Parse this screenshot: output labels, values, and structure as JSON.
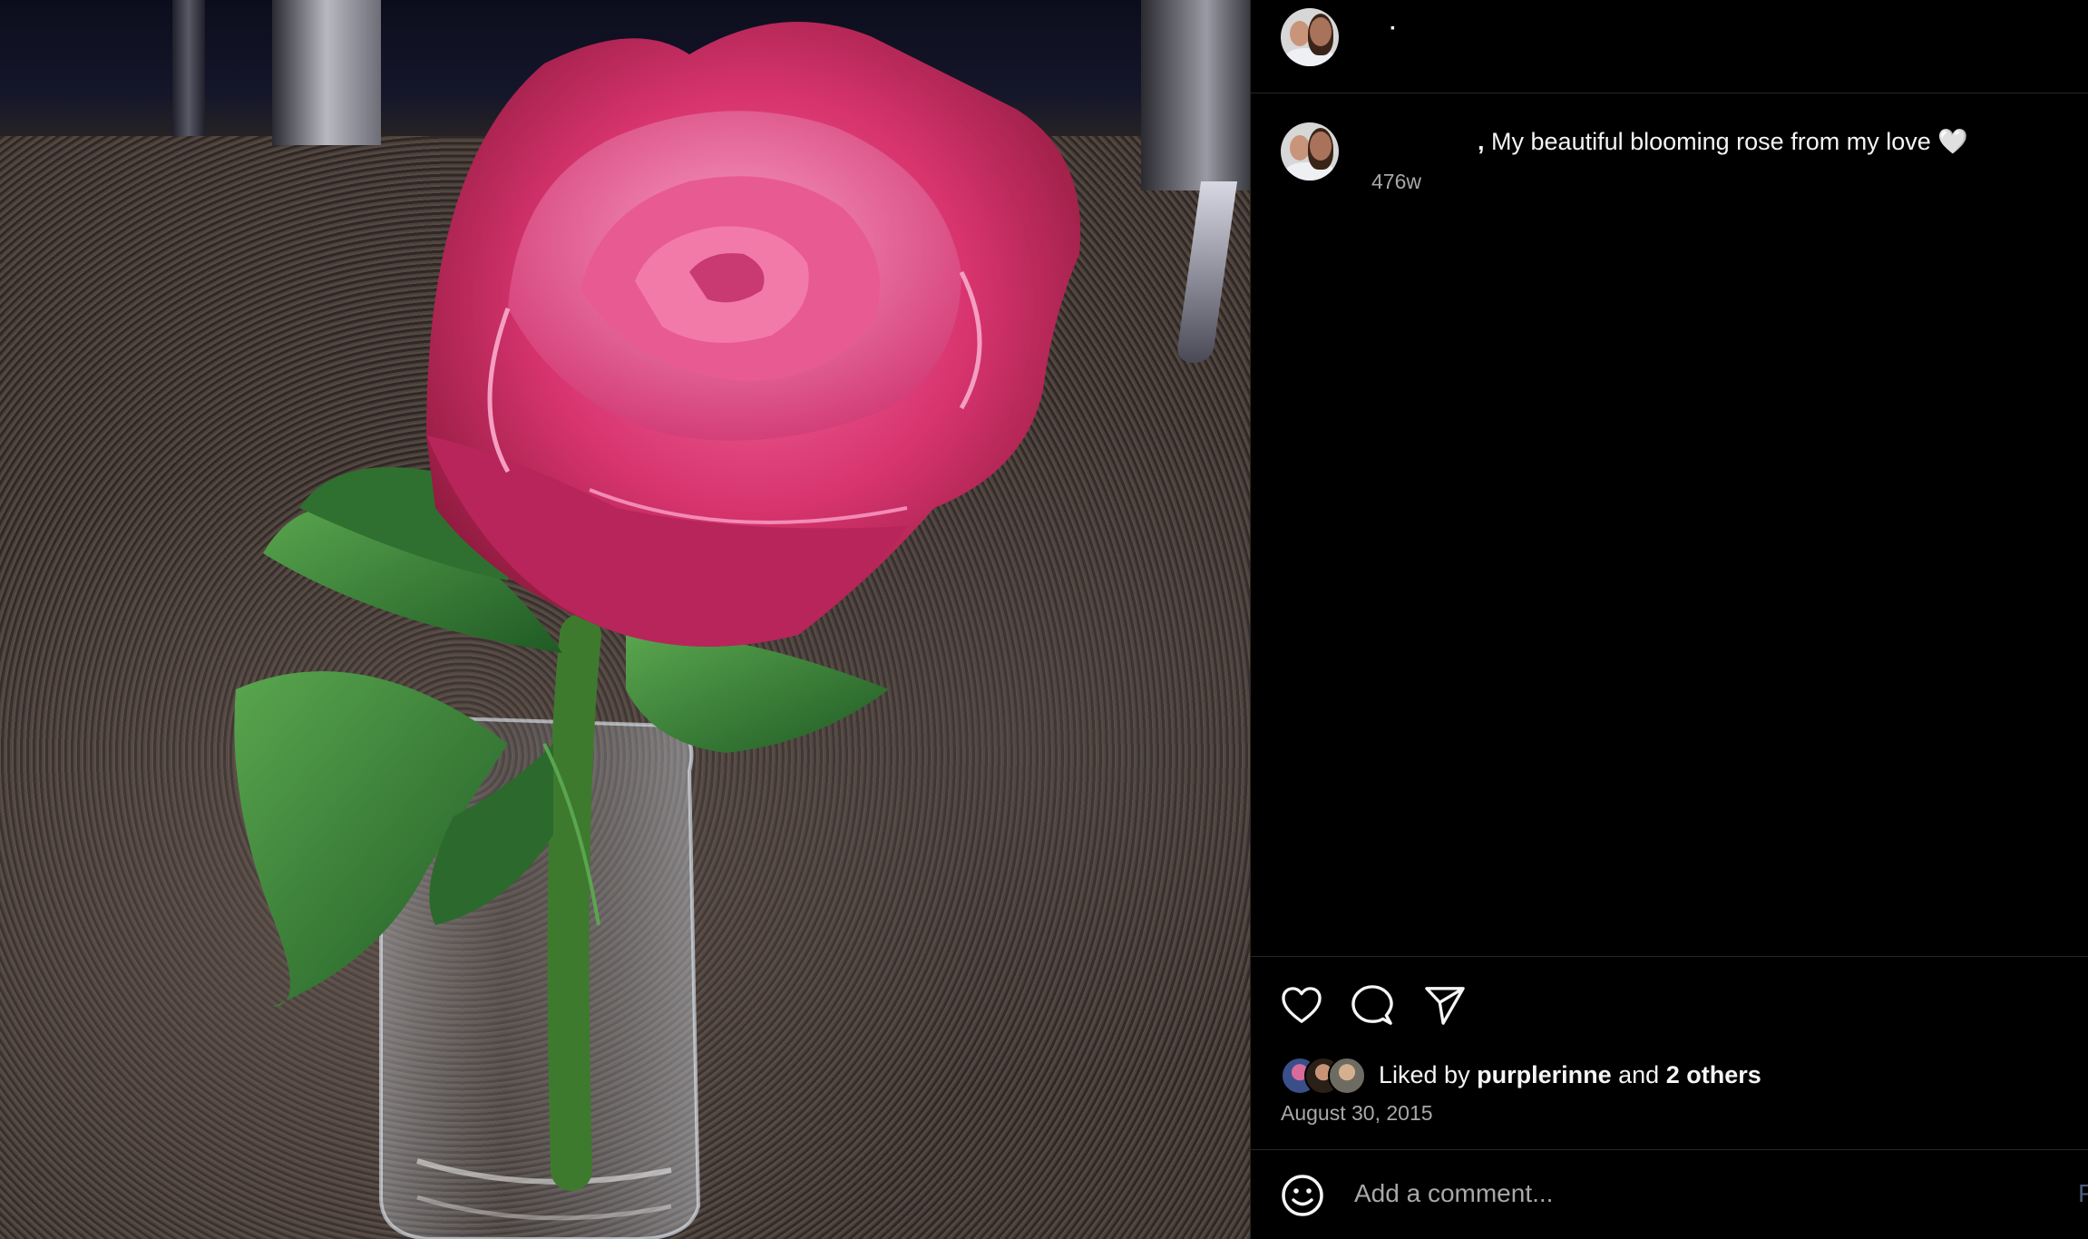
{
  "post": {
    "username": "·",
    "caption_username": ",",
    "caption_text": "My beautiful blooming rose from my love 🤍",
    "caption_age": "476w"
  },
  "likes": {
    "prefix": "Liked by",
    "first_user": "purplerinne",
    "joiner": "and",
    "others": "2 others"
  },
  "date": "August 30, 2015",
  "comment": {
    "placeholder": "Add a comment...",
    "post_label": "P"
  },
  "icons": {
    "like": "heart-icon",
    "comment": "comment-bubble-icon",
    "share": "paper-plane-icon",
    "emoji": "smiley-icon"
  },
  "colors": {
    "background": "#000000",
    "text": "#f5f5f5",
    "secondary_text": "#a8a8a8",
    "divider": "#262626",
    "rose": "#d8346e",
    "leaf": "#3e8a3a"
  }
}
